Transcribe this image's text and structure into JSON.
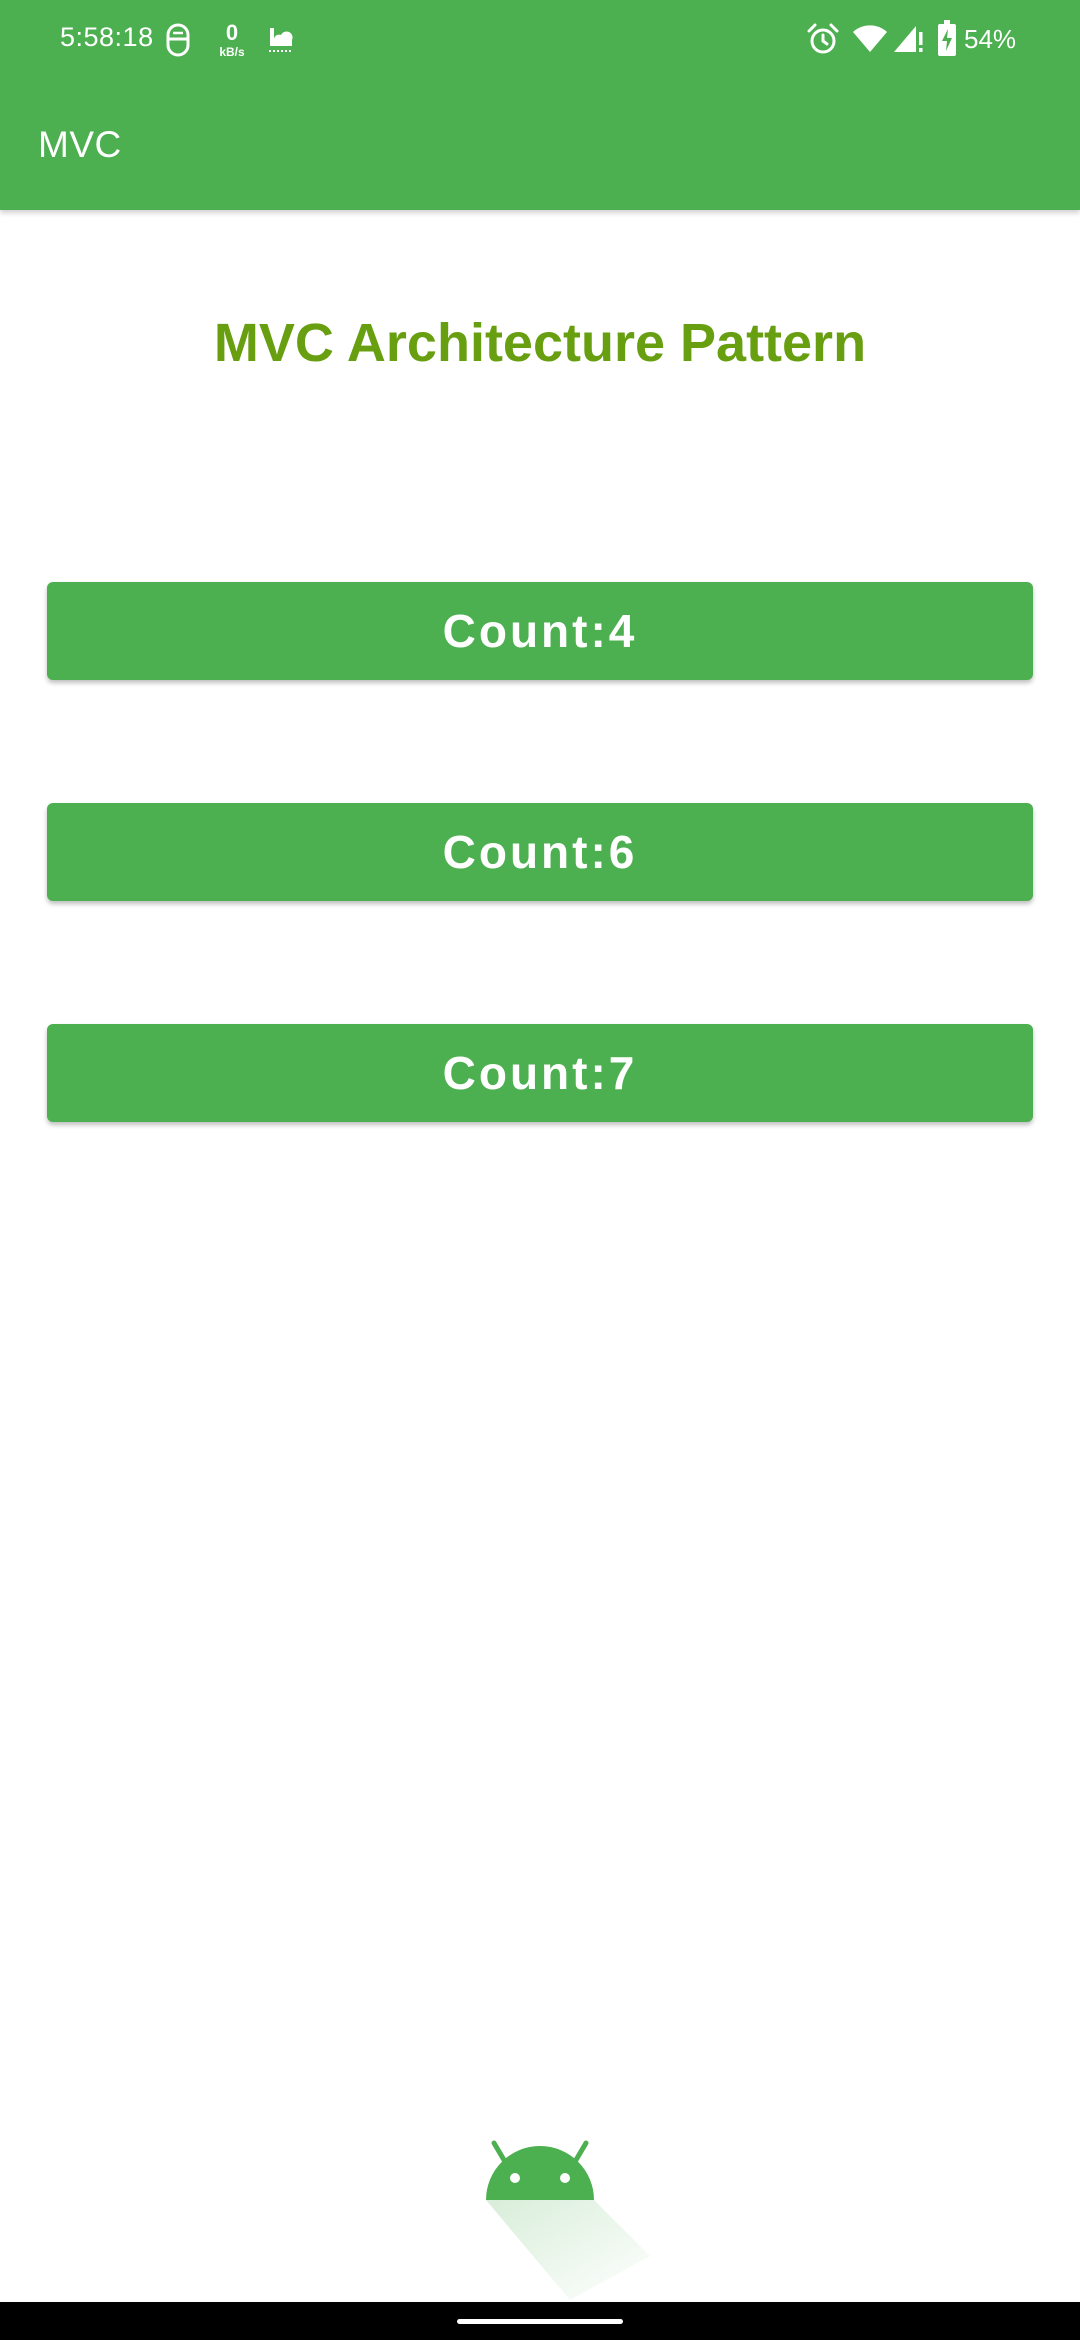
{
  "status_bar": {
    "time": "5:58:18",
    "net_speed_value": "0",
    "net_speed_unit": "kB/s",
    "battery": "54%",
    "icons": [
      "vpn-icon",
      "net-speed-icon",
      "cloud-icon",
      "alarm-icon",
      "wifi-icon",
      "signal-icon",
      "battery-charging-icon"
    ]
  },
  "app_bar": {
    "title": "MVC"
  },
  "main": {
    "title": "MVC Architecture Pattern",
    "buttons": [
      {
        "label": "Count:4"
      },
      {
        "label": "Count:6"
      },
      {
        "label": "Count:7"
      }
    ]
  },
  "colors": {
    "primary": "#4caf50",
    "title_text": "#689f11",
    "background": "#ffffff",
    "nav_bar": "#000000"
  }
}
